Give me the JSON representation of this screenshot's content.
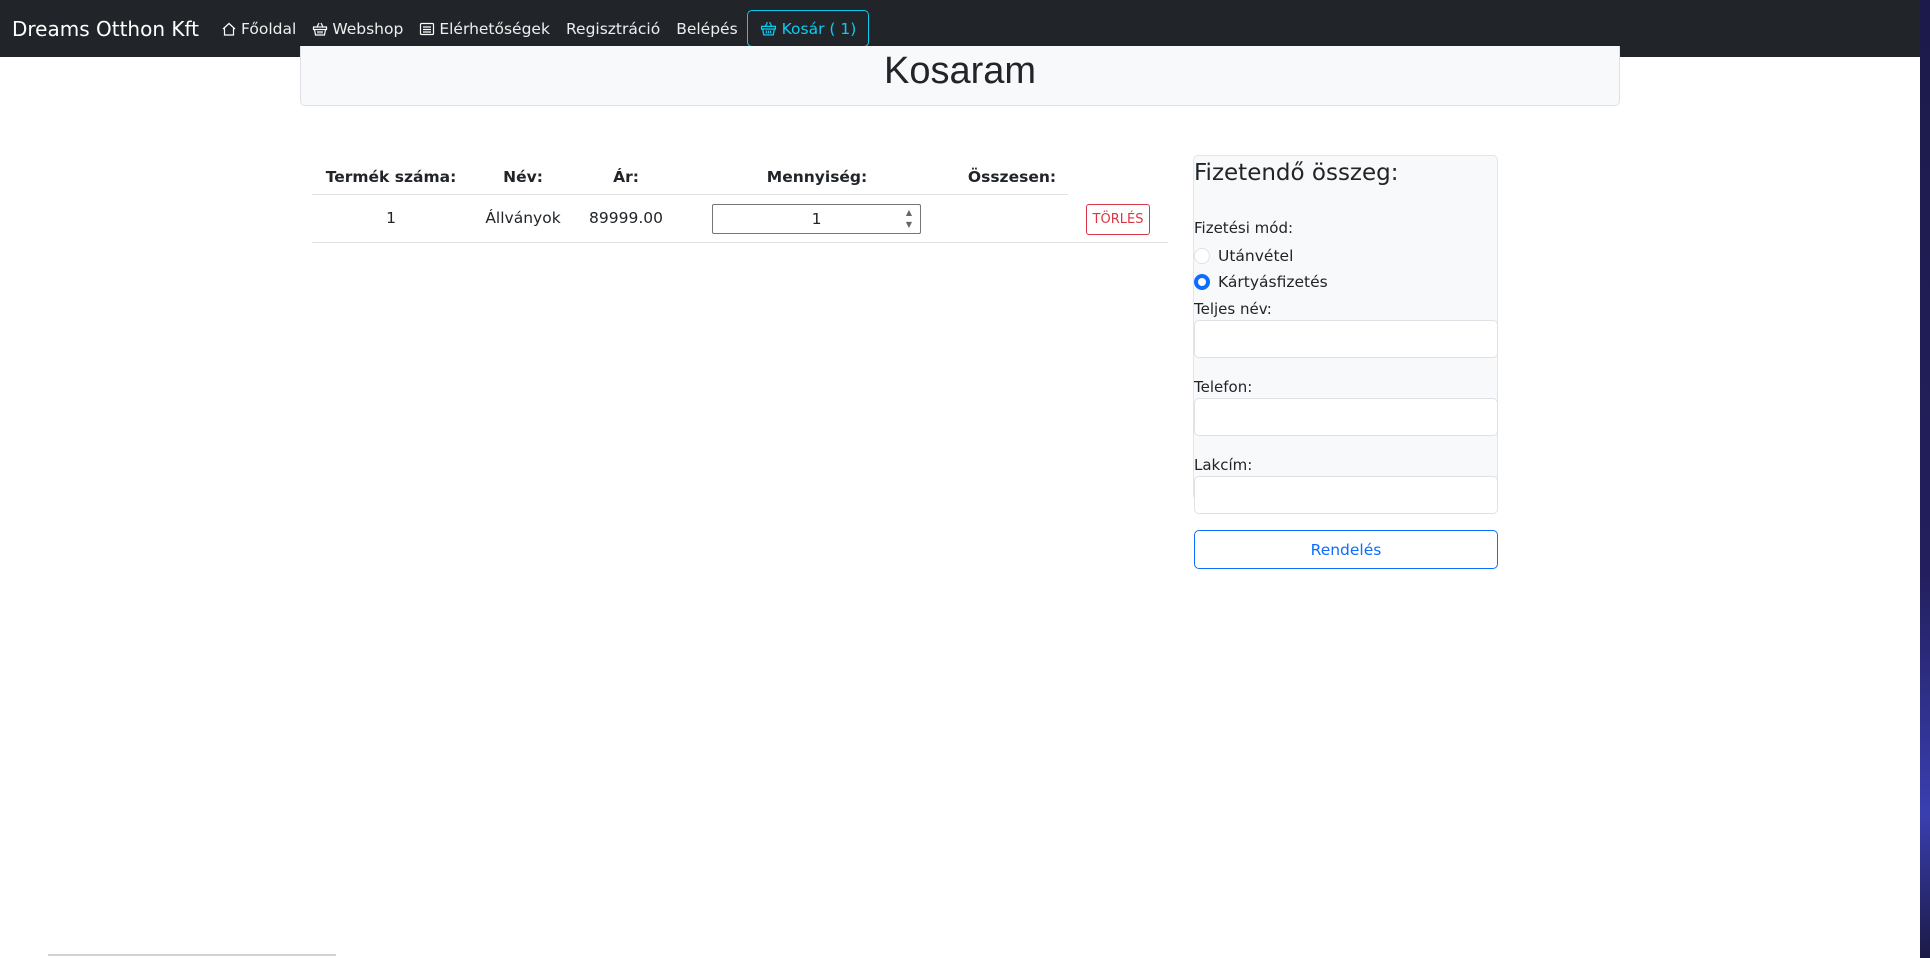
{
  "colors": {
    "navbar_bg": "#212529",
    "cart_accent": "#0dcaf0",
    "primary": "#0d6efd",
    "danger": "#dc3545"
  },
  "navbar": {
    "brand": "Dreams Otthon Kft",
    "items": [
      {
        "label": "Főoldal",
        "icon": "house-icon"
      },
      {
        "label": "Webshop",
        "icon": "basket-icon"
      },
      {
        "label": "Elérhetőségek",
        "icon": "list-icon"
      },
      {
        "label": "Regisztráció"
      },
      {
        "label": "Belépés"
      }
    ],
    "cart": {
      "label": "Kosár ( 1)",
      "icon": "basket-icon"
    }
  },
  "header": {
    "title": "Kosaram"
  },
  "cart_table": {
    "columns": [
      "Termék száma:",
      "Név:",
      "Ár:",
      "Mennyiség:",
      "Összesen:"
    ],
    "rows": [
      {
        "number": "1",
        "name": "Állványok",
        "price": "89999.00",
        "quantity": "1",
        "total": "",
        "delete_label": "TÖRLÉS"
      }
    ]
  },
  "payment": {
    "title": "Fizetendő összeg:",
    "method_label": "Fizetési mód:",
    "methods": [
      {
        "label": "Utánvétel",
        "checked": false
      },
      {
        "label": "Kártyásfizetés",
        "checked": true
      }
    ],
    "fields": [
      {
        "label": "Teljes név:",
        "value": ""
      },
      {
        "label": "Telefon:",
        "value": ""
      },
      {
        "label": "Lakcím:",
        "value": ""
      }
    ],
    "submit_label": "Rendelés"
  }
}
